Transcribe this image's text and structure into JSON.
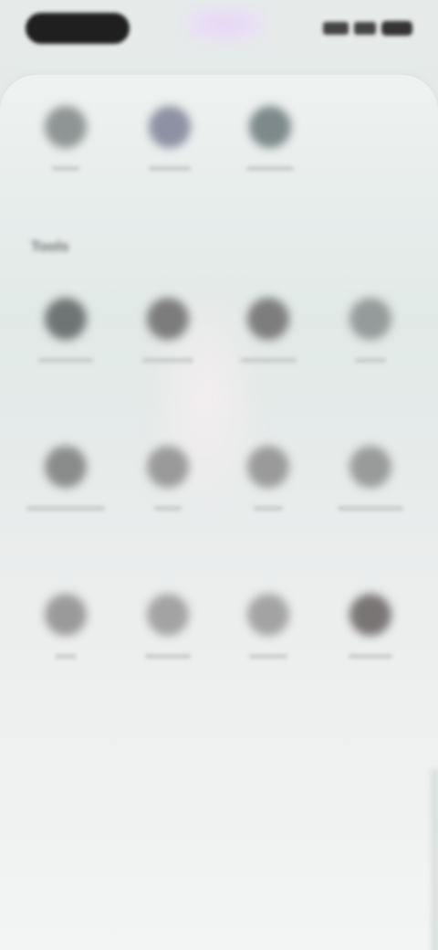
{
  "status_bar": {
    "left_pill_icon": "time-pill",
    "right_icons": [
      "signal-icon",
      "wifi-icon",
      "battery-icon"
    ]
  },
  "recent": [
    {
      "label": "",
      "icon": "app-icon-generic",
      "color": "#8f9594"
    },
    {
      "label": "",
      "icon": "app-icon-generic",
      "color": "#8d91a3"
    },
    {
      "label": "",
      "icon": "app-icon-generic",
      "color": "#7e898b"
    }
  ],
  "section": {
    "title": "Tools"
  },
  "grid": [
    {
      "label": "",
      "icon": "app-icon-generic",
      "color": "#6f7574"
    },
    {
      "label": "",
      "icon": "app-icon-generic",
      "color": "#7c7c7c"
    },
    {
      "label": "",
      "icon": "app-icon-generic",
      "color": "#7d7d7d"
    },
    {
      "label": "",
      "icon": "app-icon-generic",
      "color": "#959b9a"
    },
    {
      "label": "",
      "icon": "app-icon-generic",
      "color": "#8a8c8c"
    },
    {
      "label": "",
      "icon": "app-icon-generic",
      "color": "#9a9a9a"
    },
    {
      "label": "",
      "icon": "app-icon-generic",
      "color": "#9a9a9a"
    },
    {
      "label": "",
      "icon": "app-icon-generic",
      "color": "#999b9b"
    },
    {
      "label": "",
      "icon": "app-icon-generic",
      "color": "#9a9a9a"
    },
    {
      "label": "",
      "icon": "app-icon-generic",
      "color": "#a3a3a3"
    },
    {
      "label": "",
      "icon": "app-icon-generic",
      "color": "#a3a3a3"
    },
    {
      "label": "",
      "icon": "app-icon-generic",
      "color": "#7a7575"
    }
  ]
}
